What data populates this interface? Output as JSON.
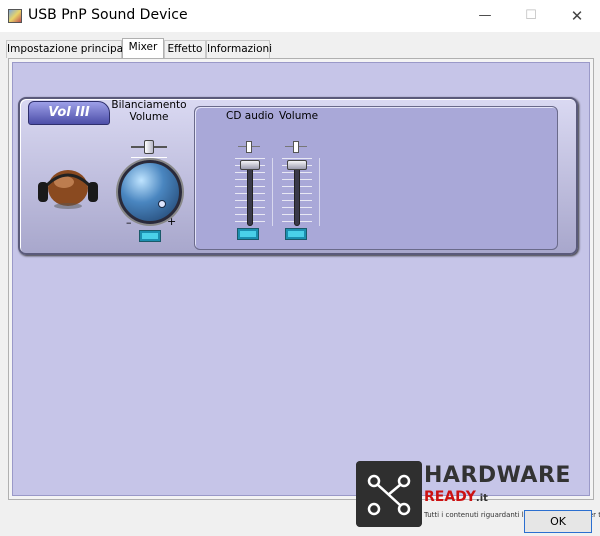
{
  "window": {
    "title": "USB PnP Sound Device",
    "minimize_glyph": "—",
    "maximize_glyph": "☐",
    "close_glyph": "✕"
  },
  "tabs": [
    {
      "label": "Impostazione principale",
      "active": false
    },
    {
      "label": "Mixer",
      "active": true
    },
    {
      "label": "Effetto",
      "active": false
    },
    {
      "label": "Informazioni",
      "active": false
    }
  ],
  "mixer": {
    "badge": "Vol III",
    "balance_label": "Bilanciamento\nVolume",
    "minus": "–",
    "plus": "+",
    "channels": [
      {
        "label": "CD audio",
        "level": 1.0
      },
      {
        "label": "Volume",
        "level": 1.0
      }
    ]
  },
  "buttons": {
    "ok": "OK"
  },
  "watermark": {
    "line1": "HARDWARE",
    "line2": "READY",
    "line2_suffix": ".it",
    "caption": "Tutti i contenuti riguardanti l'Hardware pronti per te!"
  },
  "icons": {
    "app": "sound-card-icon",
    "headphone": "headphone-icon",
    "volume_knob": "volume-knob-icon"
  }
}
